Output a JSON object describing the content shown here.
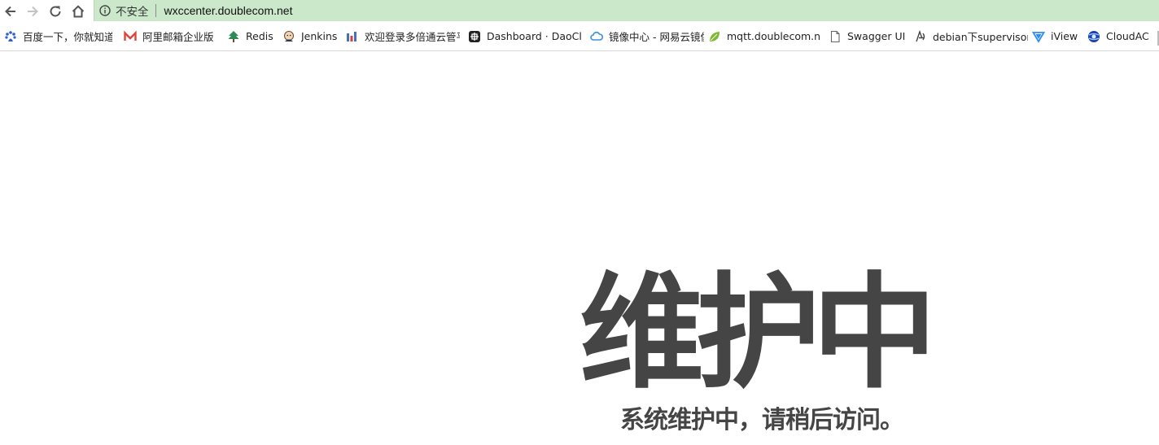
{
  "browser": {
    "security_label": "不安全",
    "url": "wxccenter.doublecom.net",
    "icons": {
      "back": "back-arrow-icon",
      "forward": "forward-arrow-icon",
      "reload": "reload-icon",
      "home": "home-icon",
      "info": "info-icon"
    }
  },
  "bookmarks": [
    {
      "label": "百度一下，你就知道",
      "icon": "baidu-paw-icon",
      "color": "#2a5fd8"
    },
    {
      "label": "阿里邮箱企业版",
      "icon": "mail-m-icon",
      "color": "#e0443a"
    },
    {
      "label": "Redis",
      "icon": "tree-icon",
      "color": "#2e8b57"
    },
    {
      "label": "Jenkins",
      "icon": "jenkins-icon",
      "color": "#b5835a"
    },
    {
      "label": "欢迎登录多倍通云管平",
      "icon": "cloud-logo-icon",
      "color": "#4a6fc0"
    },
    {
      "label": "Dashboard · DaoClo",
      "icon": "daocloud-icon",
      "color": "#222222"
    },
    {
      "label": "镜像中心 - 网易云镜像",
      "icon": "netease-cloud-icon",
      "color": "#3d8fe0"
    },
    {
      "label": "mqtt.doublecom.ne",
      "icon": "leaf-icon",
      "color": "#7cbb2f"
    },
    {
      "label": "Swagger UI",
      "icon": "page-icon",
      "color": "#666666"
    },
    {
      "label": "debian下supervisor",
      "icon": "debian-icon",
      "color": "#444444"
    },
    {
      "label": "iView",
      "icon": "iview-icon",
      "color": "#2d8cf0"
    },
    {
      "label": "CloudAC",
      "icon": "globe-icon",
      "color": "#1a3fb8"
    }
  ],
  "page": {
    "title": "维护中",
    "subtitle": "系统维护中，请稍后访问。"
  },
  "colors": {
    "omnibox_bg": "#cbe8cb",
    "heading": "#454545"
  }
}
